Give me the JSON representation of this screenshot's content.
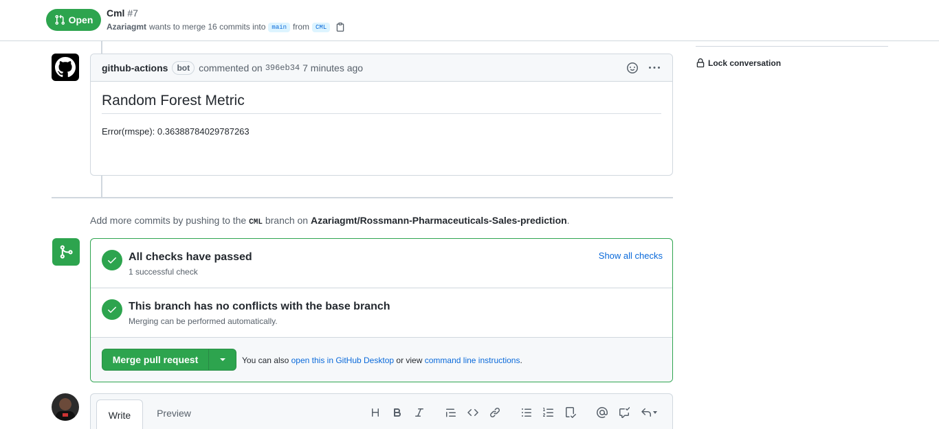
{
  "header": {
    "state": "Open",
    "title": "Cml",
    "number": "#7",
    "author": "Azariagmt",
    "meta_text": "wants to merge 16 commits into",
    "base_branch": "main",
    "from_text": "from",
    "head_branch": "CML"
  },
  "comment": {
    "author": "github-actions",
    "bot_label": "bot",
    "action_text": "commented on",
    "sha": "396eb34",
    "time": "7 minutes ago",
    "heading": "Random Forest Metric",
    "body": "Error(rmspe): 0.36388784029787263"
  },
  "push_hint": {
    "prefix": "Add more commits by pushing to the",
    "branch": "CML",
    "middle": "branch on",
    "repo": "Azariagmt/Rossmann-Pharmaceuticals-Sales-prediction",
    "suffix": "."
  },
  "merge_box": {
    "checks_title": "All checks have passed",
    "checks_sub": "1 successful check",
    "show_all": "Show all checks",
    "conflicts_title": "This branch has no conflicts with the base branch",
    "conflicts_sub": "Merging can be performed automatically.",
    "merge_button": "Merge pull request",
    "alt_prefix": "You can also",
    "alt_link1": "open this in GitHub Desktop",
    "alt_middle": "or view",
    "alt_link2": "command line instructions",
    "alt_suffix": "."
  },
  "composer": {
    "tab_write": "Write",
    "tab_preview": "Preview",
    "tools": [
      "heading-icon",
      "bold-icon",
      "italic-icon",
      "quote-icon",
      "code-icon",
      "link-icon",
      "unordered-list-icon",
      "ordered-list-icon",
      "task-list-icon",
      "mention-icon",
      "cross-reference-icon",
      "reply-icon"
    ]
  },
  "sidebar": {
    "lock_label": "Lock conversation"
  },
  "colors": {
    "success": "#2da44e",
    "link": "#0969da",
    "border": "#d0d7de",
    "muted": "#57606a"
  }
}
